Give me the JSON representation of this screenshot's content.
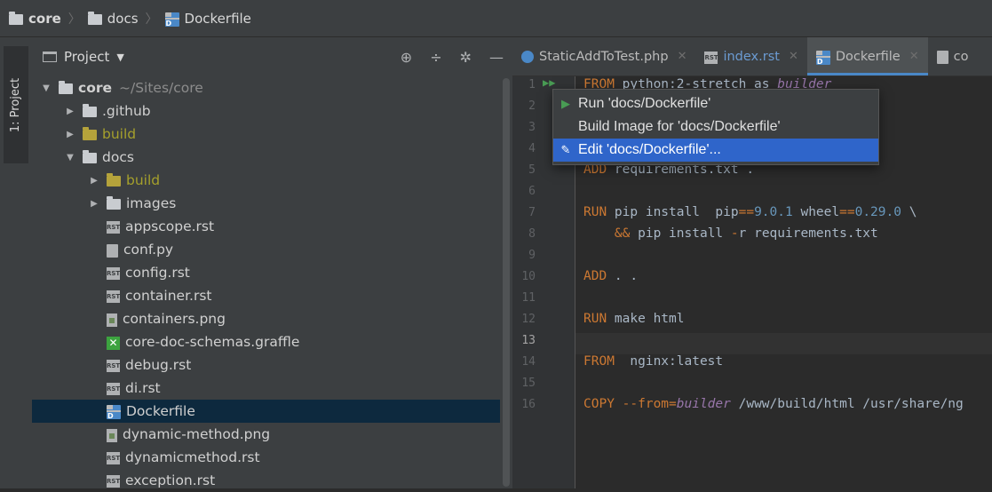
{
  "breadcrumb": {
    "items": [
      "core",
      "docs",
      "Dockerfile"
    ]
  },
  "side_strip": {
    "label": "1: Project"
  },
  "project": {
    "title": "Project",
    "tree": [
      {
        "label": "core",
        "extra": "~/Sites/core",
        "kind": "folder",
        "depth": 0,
        "expanded": true
      },
      {
        "label": ".github",
        "kind": "folder",
        "depth": 1,
        "expanded": false
      },
      {
        "label": "build",
        "kind": "folder-excluded",
        "depth": 1,
        "expanded": false
      },
      {
        "label": "docs",
        "kind": "folder",
        "depth": 1,
        "expanded": true
      },
      {
        "label": "build",
        "kind": "folder-excluded",
        "depth": 2,
        "expanded": false
      },
      {
        "label": "images",
        "kind": "folder",
        "depth": 2,
        "expanded": false
      },
      {
        "label": "appscope.rst",
        "kind": "rst",
        "depth": 2
      },
      {
        "label": "conf.py",
        "kind": "file",
        "depth": 2
      },
      {
        "label": "config.rst",
        "kind": "rst",
        "depth": 2
      },
      {
        "label": "container.rst",
        "kind": "rst",
        "depth": 2
      },
      {
        "label": "containers.png",
        "kind": "png",
        "depth": 2
      },
      {
        "label": "core-doc-schemas.graffle",
        "kind": "graffle",
        "depth": 2
      },
      {
        "label": "debug.rst",
        "kind": "rst",
        "depth": 2
      },
      {
        "label": "di.rst",
        "kind": "rst",
        "depth": 2
      },
      {
        "label": "Dockerfile",
        "kind": "docker",
        "depth": 2,
        "selected": true
      },
      {
        "label": "dynamic-method.png",
        "kind": "png",
        "depth": 2
      },
      {
        "label": "dynamicmethod.rst",
        "kind": "rst",
        "depth": 2
      },
      {
        "label": "exception.rst",
        "kind": "rst",
        "depth": 2
      }
    ]
  },
  "tabs": [
    {
      "label": "StaticAddToTest.php",
      "icon": "php-icon"
    },
    {
      "label": "index.rst",
      "icon": "rst-icon"
    },
    {
      "label": "Dockerfile",
      "icon": "docker-icon",
      "active": true
    },
    {
      "label": "co",
      "icon": "file-icon"
    }
  ],
  "editor": {
    "current_line": 13,
    "lines": [
      "FROM python:2-stretch as builder",
      "",
      "",
      "",
      "ADD requirements.txt .",
      "",
      "RUN pip install  pip==9.0.1 wheel==0.29.0 \\",
      "    && pip install -r requirements.txt",
      "",
      "ADD . .",
      "",
      "RUN make html",
      "",
      "FROM  nginx:latest",
      "",
      "COPY --from=builder /www/build/html /usr/share/ng"
    ]
  },
  "popup": {
    "items": [
      {
        "label": "Run 'docs/Dockerfile'",
        "icon": "run-icon"
      },
      {
        "label": "Build Image for 'docs/Dockerfile'",
        "icon": ""
      },
      {
        "label": "Edit 'docs/Dockerfile'...",
        "icon": "edit-icon",
        "selected": true
      }
    ]
  },
  "colors": {
    "accent": "#2f65ca",
    "selection": "#0d293e",
    "keyword": "#cc7832",
    "number": "#6897bb"
  }
}
